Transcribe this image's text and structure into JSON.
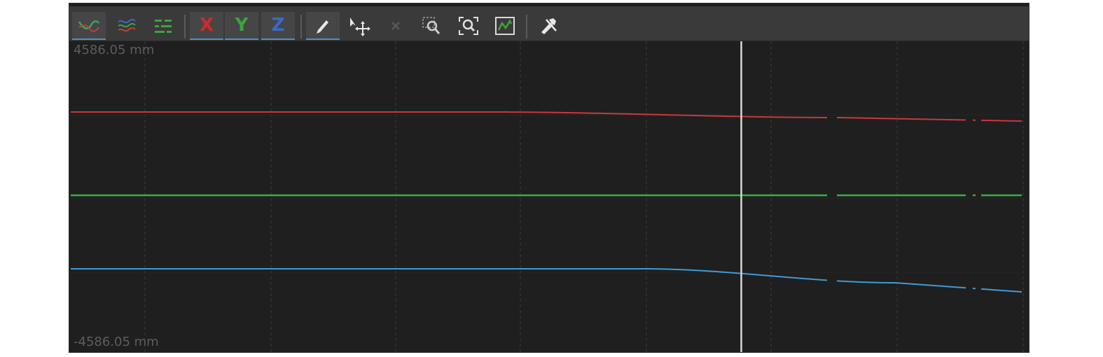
{
  "axis": {
    "max_label": "4586.05 mm",
    "min_label": "-4586.05 mm"
  },
  "toolbar": {
    "axes": [
      {
        "glyph": "X",
        "color": "#d02a2a"
      },
      {
        "glyph": "Y",
        "color": "#3ea33e"
      },
      {
        "glyph": "Z",
        "color": "#3b68c9"
      }
    ]
  },
  "colors": {
    "x_curve": "#c8383c",
    "y_curve": "#37b044",
    "z_curve": "#3f9ad6",
    "cursor": "#d8d8d8",
    "grid": "#3b3b3b",
    "accent": "#4f8ecf"
  },
  "curves": {
    "x_break_fractions": [
      0.8,
      0.945,
      0.955
    ],
    "y_break_fractions": [
      0.8,
      0.945,
      0.955
    ],
    "z_break_fractions": [
      0.8,
      0.945,
      0.955
    ],
    "time_cursor_fraction": 0.697
  }
}
